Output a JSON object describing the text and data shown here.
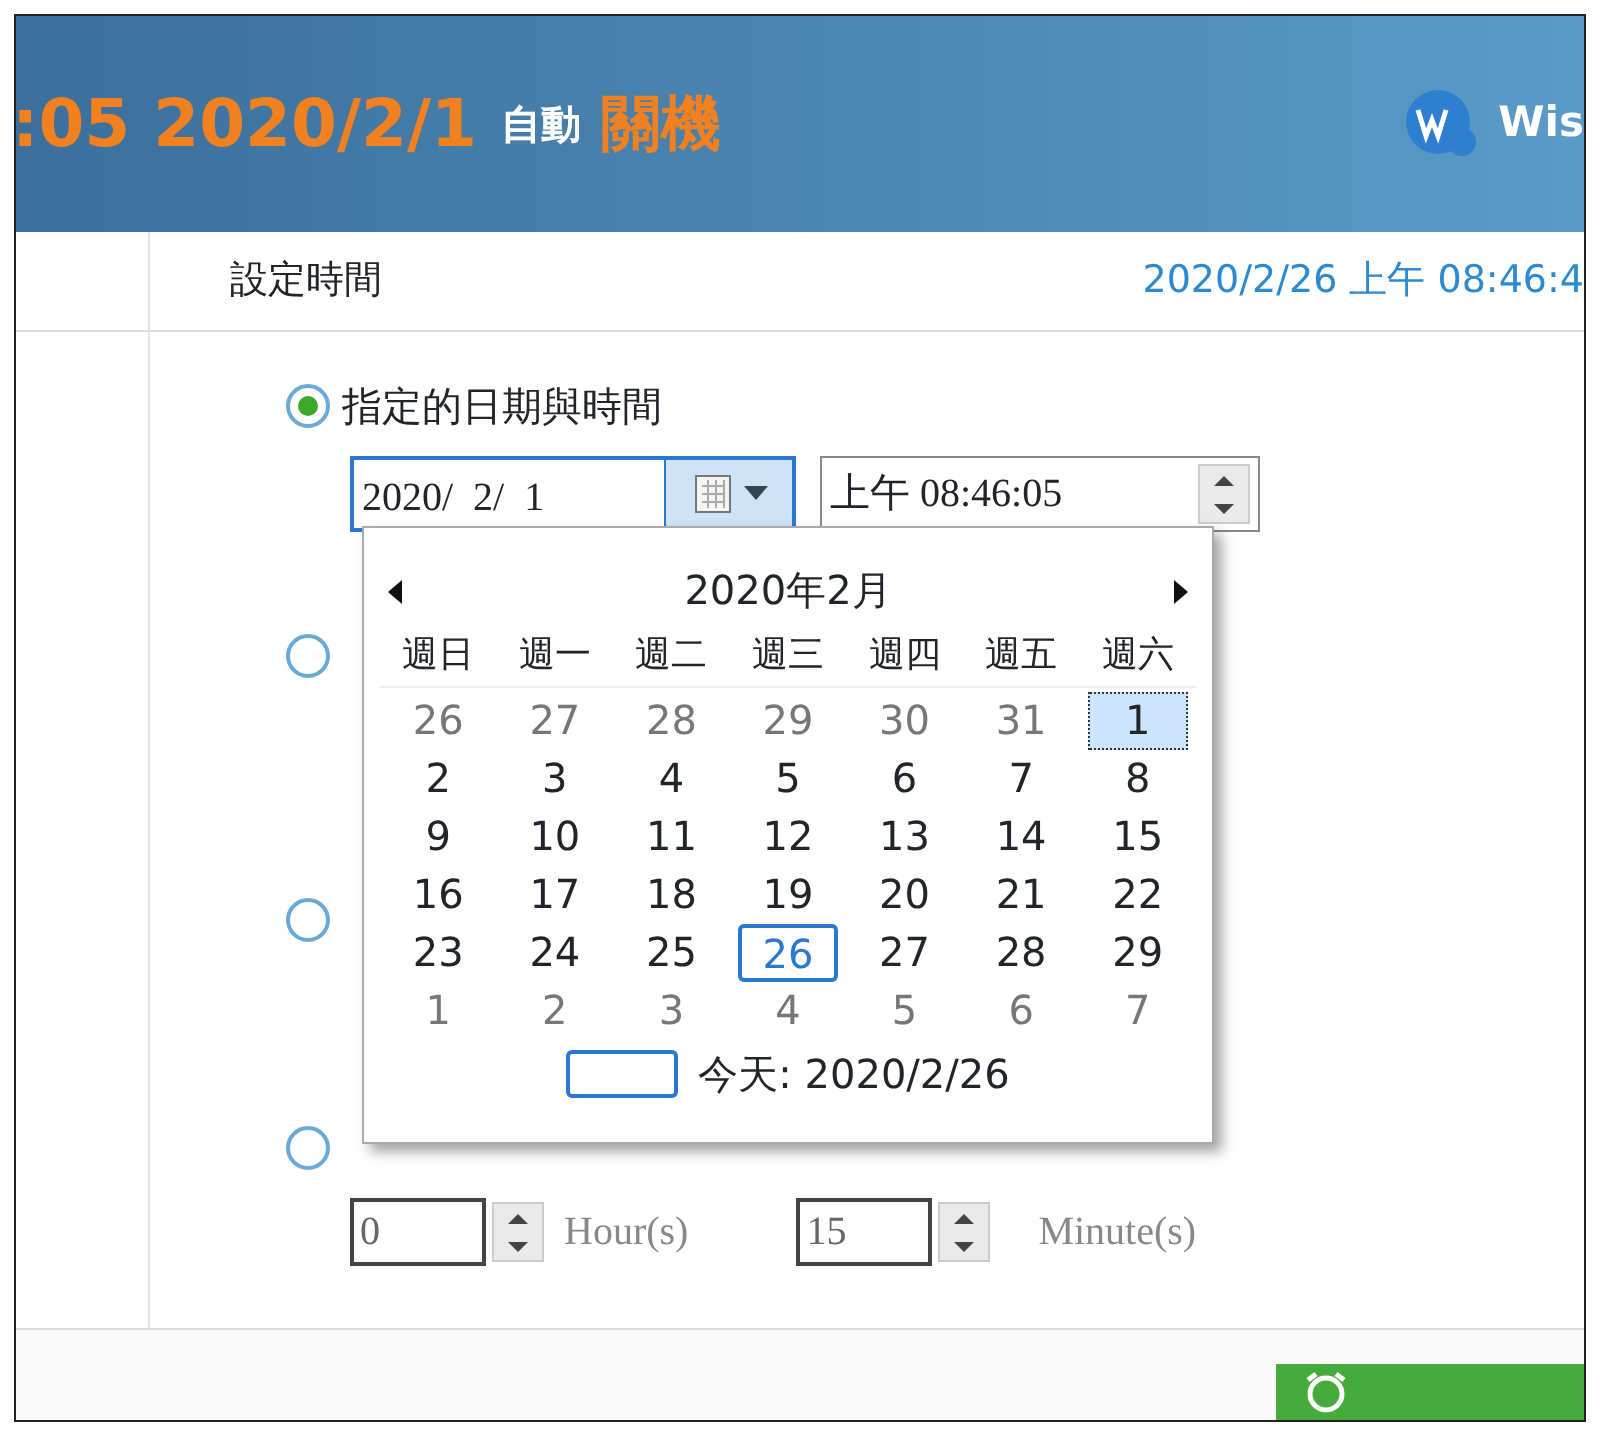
{
  "header": {
    "clock_text": ":05 2020/2/1",
    "mode": "自動",
    "action": "關機",
    "brand": "Wis"
  },
  "section": {
    "title": "設定時間",
    "current_time": "2020/2/26 上午 08:46:4"
  },
  "options": [
    {
      "kind": "datetime",
      "label": "指定的日期與時間",
      "selected": true,
      "date_value": "2020/  2/  1",
      "time_value": "上午 08:46:05"
    },
    {
      "kind": "plain",
      "selected": false
    },
    {
      "kind": "plain",
      "selected": false
    },
    {
      "kind": "idle",
      "selected": false,
      "hours": "0",
      "hours_unit": "Hour(s)",
      "minutes": "15",
      "minutes_unit": "Minute(s)"
    }
  ],
  "calendar": {
    "month_title": "2020年2月",
    "weekdays": [
      "週日",
      "週一",
      "週二",
      "週三",
      "週四",
      "週五",
      "週六"
    ],
    "weeks": [
      [
        {
          "day": "26",
          "other_month": true
        },
        {
          "day": "27",
          "other_month": true
        },
        {
          "day": "28",
          "other_month": true
        },
        {
          "day": "29",
          "other_month": true
        },
        {
          "day": "30",
          "other_month": true
        },
        {
          "day": "31",
          "other_month": true
        },
        {
          "day": "1",
          "selected": true
        }
      ],
      [
        {
          "day": "2"
        },
        {
          "day": "3"
        },
        {
          "day": "4"
        },
        {
          "day": "5"
        },
        {
          "day": "6"
        },
        {
          "day": "7"
        },
        {
          "day": "8"
        }
      ],
      [
        {
          "day": "9"
        },
        {
          "day": "10"
        },
        {
          "day": "11"
        },
        {
          "day": "12"
        },
        {
          "day": "13"
        },
        {
          "day": "14"
        },
        {
          "day": "15"
        }
      ],
      [
        {
          "day": "16"
        },
        {
          "day": "17"
        },
        {
          "day": "18"
        },
        {
          "day": "19"
        },
        {
          "day": "20"
        },
        {
          "day": "21"
        },
        {
          "day": "22"
        }
      ],
      [
        {
          "day": "23"
        },
        {
          "day": "24"
        },
        {
          "day": "25"
        },
        {
          "day": "26",
          "today": true
        },
        {
          "day": "27"
        },
        {
          "day": "28"
        },
        {
          "day": "29"
        }
      ],
      [
        {
          "day": "1",
          "other_month": true
        },
        {
          "day": "2",
          "other_month": true
        },
        {
          "day": "3",
          "other_month": true
        },
        {
          "day": "4",
          "other_month": true
        },
        {
          "day": "5",
          "other_month": true
        },
        {
          "day": "6",
          "other_month": true
        },
        {
          "day": "7",
          "other_month": true
        }
      ]
    ],
    "today_label": "今天: 2020/2/26"
  }
}
